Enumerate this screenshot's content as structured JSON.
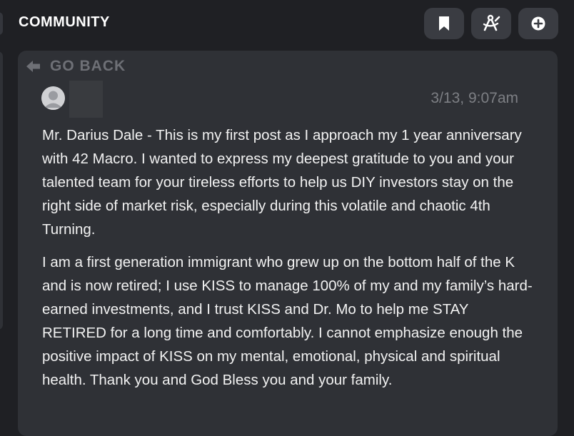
{
  "header": {
    "title": "COMMUNITY",
    "buttons": [
      {
        "name": "bookmark-button",
        "icon": "bookmark-icon"
      },
      {
        "name": "tools-button",
        "icon": "compass-pencil-icon"
      },
      {
        "name": "add-button",
        "icon": "plus-circle-icon"
      }
    ]
  },
  "nav": {
    "go_back_label": "GO BACK"
  },
  "post": {
    "timestamp": "3/13, 9:07am",
    "paragraphs": [
      "Mr. Darius Dale - This is my first post as I approach my 1 year anniversary with 42 Macro. I wanted to express my deepest gratitude to you and your talented team for your tireless efforts to help us DIY investors stay on the right side of market risk, especially during this volatile and chaotic 4th Turning.",
      "I am a first generation immigrant who grew up on the bottom half of the K and is now retired; I use KISS to manage 100% of my and my family’s hard-earned investments, and I trust KISS and Dr. Mo to help me STAY RETIRED for a long time and comfortably. I cannot emphasize enough the positive impact of KISS on my mental, emotional, physical and spiritual health. Thank you and God Bless you and your family."
    ]
  },
  "colors": {
    "background": "#1f2024",
    "card": "#2f3136",
    "button": "#3a3c42",
    "text": "#f2f2f2",
    "muted": "#6e7076"
  }
}
